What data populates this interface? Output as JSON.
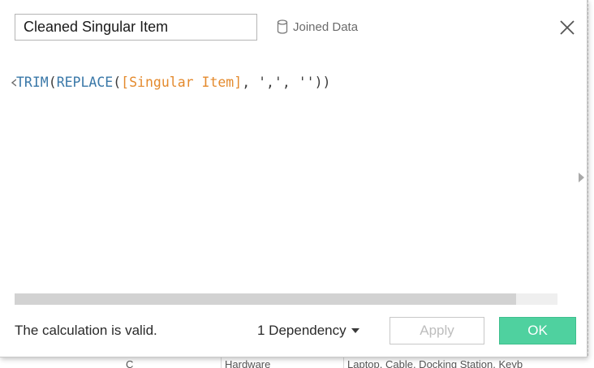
{
  "calc_name": "Cleaned Singular Item",
  "datasource": {
    "label": "Joined Data",
    "icon": "database-icon"
  },
  "editor": {
    "tokens": {
      "trim": "TRIM",
      "open1": "(",
      "replace": "REPLACE",
      "open2": "(",
      "field": "[Singular Item]",
      "comma_space": ", ",
      "arg2": "','",
      "comma_space2": ", ",
      "arg3": "''",
      "close": "))"
    }
  },
  "footer": {
    "status": "The calculation is valid.",
    "dependency_label": "1 Dependency",
    "apply_label": "Apply",
    "ok_label": "OK"
  },
  "background": {
    "cells": [
      "C",
      "Hardware",
      "Laptop, Cable, Docking Station, Keyb"
    ]
  },
  "colors": {
    "function": "#3a78a8",
    "field": "#e48a2d",
    "ok_button": "#4fd19f",
    "apply_text_disabled": "#bdbdbd"
  },
  "scrollbar": {
    "position": 0.0,
    "visible_fraction": 0.92
  }
}
